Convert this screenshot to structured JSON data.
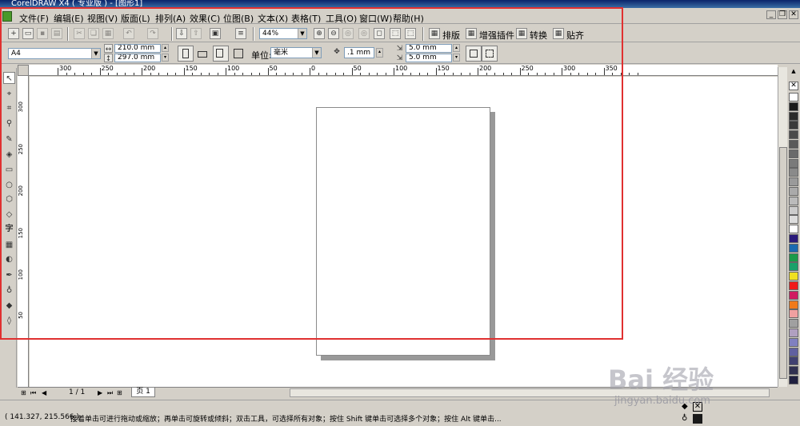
{
  "title_bar": {
    "text": "CorelDRAW X4 ( 专业版 ) - [图形1]"
  },
  "menu": [
    {
      "label": "文件(F)"
    },
    {
      "label": "编辑(E)"
    },
    {
      "label": "视图(V)"
    },
    {
      "label": "版面(L)"
    },
    {
      "label": "排列(A)"
    },
    {
      "label": "效果(C)"
    },
    {
      "label": "位图(B)"
    },
    {
      "label": "文本(X)"
    },
    {
      "label": "表格(T)"
    },
    {
      "label": "工具(O)"
    },
    {
      "label": "窗口(W)"
    },
    {
      "label": "帮助(H)"
    }
  ],
  "toolbar": {
    "zoom": "44%",
    "layout_label": "排版",
    "plugin_label": "增强插件",
    "convert_label": "转换",
    "snap_label": "贴齐"
  },
  "property_bar": {
    "paper_size": "A4",
    "width": "210.0 mm",
    "height": "297.0 mm",
    "unit_label": "单位:",
    "unit_value": "毫米",
    "nudge": ".1 mm",
    "dup_x": "5.0 mm",
    "dup_y": "5.0 mm"
  },
  "ruler": {
    "h_labels": [
      "300",
      "250",
      "200",
      "150",
      "100",
      "50",
      "0",
      "50",
      "100",
      "150",
      "200",
      "250",
      "300",
      "350"
    ],
    "v_labels": [
      "300",
      "250",
      "200",
      "150",
      "100",
      "50"
    ]
  },
  "page_nav": {
    "page_count": "1 / 1",
    "page_tab": "页 1"
  },
  "status": {
    "coords": "( 141.327, 215.566 )",
    "message": "接着单击可进行拖动或缩放；再单击可旋转或倾斜；双击工具，可选择所有对象；按住 Shift 键单击可选择多个对象；按住 Alt 键单击..."
  },
  "palette": [
    "#ffffff",
    "#1a1a1a",
    "#2a2a2a",
    "#3a3a3a",
    "#4a4a4a",
    "#5a5a5a",
    "#6a6a6a",
    "#7a7a7a",
    "#8a8a8a",
    "#9a9a9a",
    "#aaaaaa",
    "#bbbbbb",
    "#cccccc",
    "#dddddd",
    "#ffffff",
    "#2a1a7a",
    "#1a6ab0",
    "#1a9a4a",
    "#1aa06a",
    "#f0e020",
    "#f01a1a",
    "#d01a60",
    "#f07a1a",
    "#f0a0a0",
    "#a0a0a0",
    "#b0a0c0",
    "#8080c0",
    "#6060a0",
    "#404070",
    "#303050",
    "#202040"
  ],
  "watermark": {
    "logo_text": "Bai 经验",
    "url": "jingyan.baidu.com"
  }
}
